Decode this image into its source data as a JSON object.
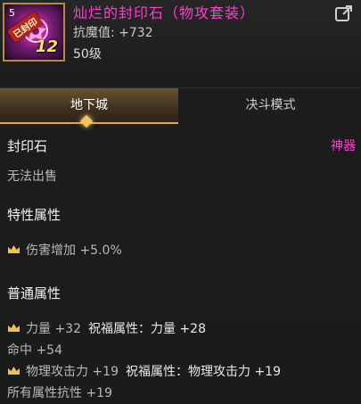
{
  "item": {
    "name": "灿烂的封印石（物攻套装）",
    "corner_text": "5",
    "tag_text": "已封印",
    "level_badge": "12",
    "resist_label": "抗魔值: +732",
    "level_label": "50级"
  },
  "tabs": [
    {
      "label": "地下城",
      "active": true
    },
    {
      "label": "决斗模式",
      "active": false
    }
  ],
  "details": {
    "type_label": "封印石",
    "rarity_label": "神器",
    "trade_label": "无法出售",
    "special_title": "特性属性",
    "special_attrs": [
      {
        "text": "伤害增加 +5.0%"
      }
    ],
    "normal_title": "普通属性",
    "normal_attrs": [
      {
        "main": "力量 +32",
        "bless_label": "祝福属性：",
        "bless_value": "力量 +28",
        "crown": true
      },
      {
        "main": "命中 +54",
        "crown": false
      },
      {
        "main": "物理攻击力 +19",
        "bless_label": "祝福属性：",
        "bless_value": "物理攻击力 +19",
        "crown": true
      },
      {
        "main": "所有属性抗性 +19",
        "crown": false
      }
    ]
  },
  "colors": {
    "title": "#ff3fd0",
    "artifact": "#ff3fd0",
    "crown": "#f0c24a"
  },
  "icons": {
    "share": "share-icon",
    "crown": "crown-icon"
  }
}
